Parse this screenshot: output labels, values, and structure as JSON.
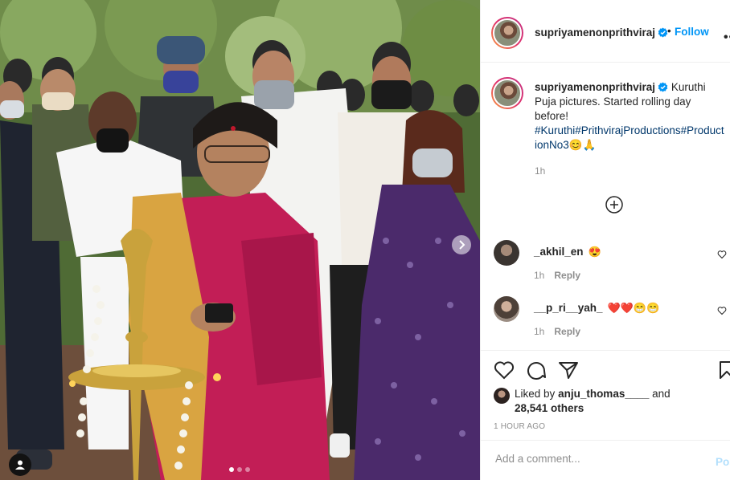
{
  "post": {
    "username": "supriyamenonprithviraj",
    "follow_sep": "•",
    "follow_label": "Follow",
    "more_label": "•••"
  },
  "caption": {
    "username": "supriyamenonprithviraj",
    "text": "Kuruthi Puja pictures. Started rolling day before!",
    "hashtags": "#Kuruthi#PrithvirajProductions#ProductionNo3",
    "emojis": "😊🙏",
    "time": "1h"
  },
  "comments": [
    {
      "username": "_akhil_en",
      "text": "😍",
      "time": "1h",
      "reply_label": "Reply"
    },
    {
      "username": "__p_ri__yah_",
      "text": "❤️❤️😁😁",
      "time": "1h",
      "reply_label": "Reply"
    }
  ],
  "likes": {
    "prefix": "Liked by",
    "liker": "anju_thomas____",
    "conjunction": "and",
    "others": "28,541 others"
  },
  "post_time": "1 HOUR AGO",
  "comment_box": {
    "placeholder": "Add a comment...",
    "post_label": "Post"
  },
  "carousel": {
    "total": 3,
    "active": 1
  },
  "colors": {
    "accent": "#0095f6",
    "verified": "#0095f6",
    "saree": "#c21e56",
    "dress": "#4b2a6b"
  },
  "icons": [
    "verified-badge-icon",
    "add-circle-icon",
    "heart-icon",
    "comment-icon",
    "share-icon",
    "bookmark-icon",
    "chevron-right-icon",
    "user-tag-icon"
  ]
}
